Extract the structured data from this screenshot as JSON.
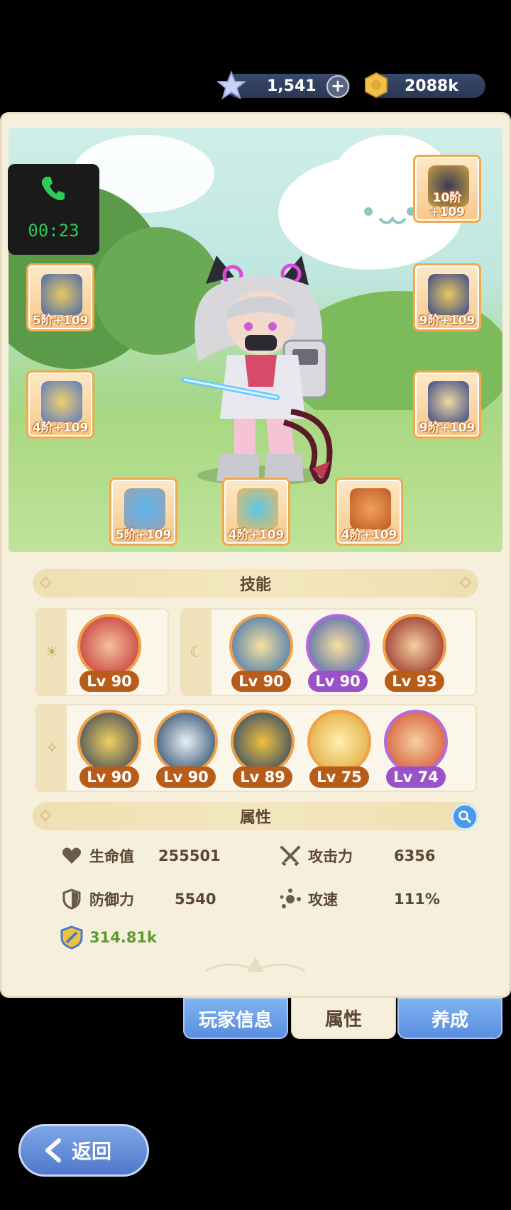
{
  "currency": {
    "stars": "1,541",
    "gold": "2088k",
    "plus_label": "+"
  },
  "call": {
    "timer": "00:23"
  },
  "equipment": [
    {
      "id": "helmet",
      "tag": "10阶+109"
    },
    {
      "id": "armor",
      "tag": "5阶+109"
    },
    {
      "id": "shoulder",
      "tag": "9阶+109"
    },
    {
      "id": "legs",
      "tag": "4阶+109"
    },
    {
      "id": "boots",
      "tag": "9阶+109"
    },
    {
      "id": "ring",
      "tag": "5阶+109"
    },
    {
      "id": "necklace",
      "tag": "4阶+109"
    },
    {
      "id": "charm",
      "tag": "4阶+109"
    }
  ],
  "skills_title": "技能",
  "skill_groups": {
    "sun": [
      {
        "lv": "Lv 90"
      }
    ],
    "moon": [
      {
        "lv": "Lv 90"
      },
      {
        "lv": "Lv 90"
      },
      {
        "lv": "Lv 93"
      }
    ],
    "star": [
      {
        "lv": "Lv 90"
      },
      {
        "lv": "Lv 90"
      },
      {
        "lv": "Lv 89"
      },
      {
        "lv": "Lv 75"
      },
      {
        "lv": "Lv 74"
      }
    ]
  },
  "attributes_title": "属性",
  "stats": {
    "hp_label": "生命值",
    "hp_value": "255501",
    "atk_label": "攻击力",
    "atk_value": "6356",
    "def_label": "防御力",
    "def_value": "5540",
    "spd_label": "攻速",
    "spd_value": "111%",
    "power_value": "314.81k"
  },
  "tabs": {
    "player_info": "玩家信息",
    "attributes": "属性",
    "cultivate": "养成"
  },
  "back_label": "返回",
  "colors": {
    "panel": "#f6efdc",
    "slot_border": "#f3a84c",
    "tab_blue": "#5a8ee0",
    "level_badge": "#b85c1a",
    "level_badge_purple": "#9a52c8"
  }
}
